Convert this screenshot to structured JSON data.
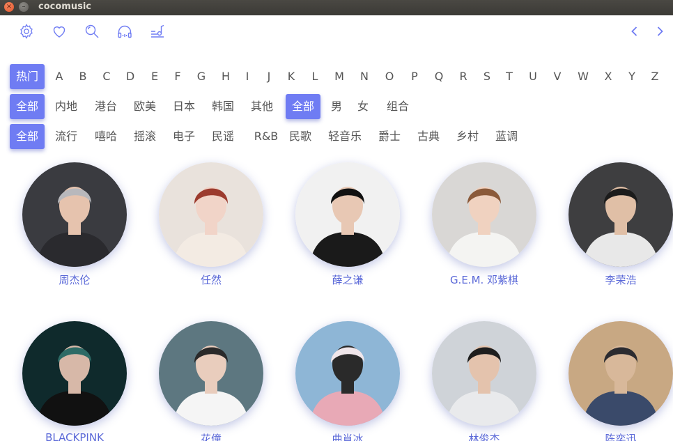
{
  "window": {
    "title": "cocomusic",
    "close_glyph": "×",
    "min_glyph": "–"
  },
  "toolbar": {
    "icons": [
      "gear-icon",
      "heart-icon",
      "search-icon",
      "headphones-icon",
      "music-note-icon"
    ],
    "back_icon": "chevron-left-icon",
    "forward_icon": "chevron-right-icon"
  },
  "filters": {
    "letters": [
      "热门",
      "A",
      "B",
      "C",
      "D",
      "E",
      "F",
      "G",
      "H",
      "I",
      "J",
      "K",
      "L",
      "M",
      "N",
      "O",
      "P",
      "Q",
      "R",
      "S",
      "T",
      "U",
      "V",
      "W",
      "X",
      "Y",
      "Z"
    ],
    "letters_selected": "热门",
    "regions": [
      "全部",
      "内地",
      "港台",
      "欧美",
      "日本",
      "韩国",
      "其他"
    ],
    "regions_selected": "全部",
    "genders": [
      "全部",
      "男",
      "女",
      "组合"
    ],
    "genders_selected": "全部",
    "genres": [
      "全部",
      "流行",
      "嘻哈",
      "摇滚",
      "电子",
      "民谣",
      "R&B",
      "民歌",
      "轻音乐",
      "爵士",
      "古典",
      "乡村",
      "蓝调"
    ],
    "genres_selected": "全部"
  },
  "artists": [
    {
      "name": "周杰伦",
      "palette": [
        "#3a3b40",
        "#b8b8bc",
        "#2a2a2e",
        "#e6c3ae"
      ]
    },
    {
      "name": "任然",
      "palette": [
        "#e9e2dc",
        "#9c3b2e",
        "#f3ebe3",
        "#f1d4c8"
      ]
    },
    {
      "name": "薛之谦",
      "palette": [
        "#f1f1f1",
        "#111111",
        "#1a1a1a",
        "#e8c8b4"
      ]
    },
    {
      "name": "G.E.M. 邓紫棋",
      "palette": [
        "#d9d7d5",
        "#8b5a3a",
        "#f4f4f2",
        "#f0d2c0"
      ]
    },
    {
      "name": "李荣浩",
      "palette": [
        "#3e3e40",
        "#1b1b1b",
        "#e8e8e8",
        "#e0bfa6"
      ]
    },
    {
      "name": "BLACKPINK",
      "palette": [
        "#0f2a2c",
        "#2d6b66",
        "#111111",
        "#d7b8a8"
      ]
    },
    {
      "name": "花僮",
      "palette": [
        "#5d7780",
        "#2a2a2a",
        "#f5f5f5",
        "#e9cdbd"
      ]
    },
    {
      "name": "曲肖冰",
      "palette": [
        "#8eb6d6",
        "#f0e6ea",
        "#e8a9b6",
        "#2a2a2a"
      ]
    },
    {
      "name": "林俊杰",
      "palette": [
        "#cfd3d8",
        "#1e1e1e",
        "#e9eaec",
        "#e4c3ad"
      ]
    },
    {
      "name": "陈奕迅",
      "palette": [
        "#c8a883",
        "#2b2b30",
        "#3a4a6a",
        "#d8b89a"
      ]
    }
  ],
  "colors": {
    "accent": "#6f7cf3",
    "artist_name": "#5a68d8",
    "text": "#555555"
  }
}
